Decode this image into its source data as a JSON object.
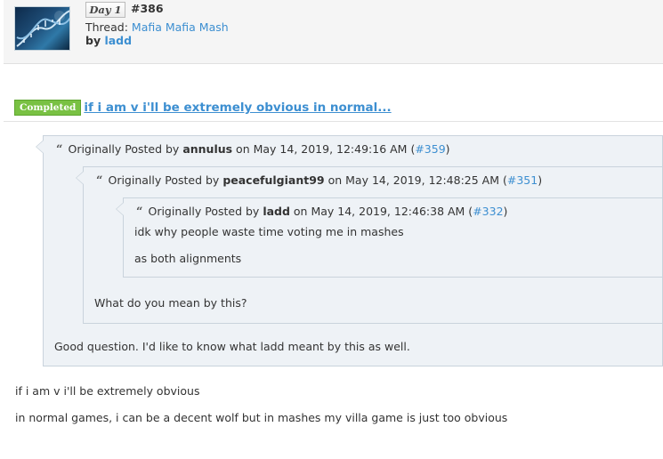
{
  "header": {
    "day_label": "Day 1",
    "post_number": "#386",
    "thread_prefix": "Thread: ",
    "thread_name": "Mafia Mafia Mash",
    "by_prefix": "by ",
    "author": "ladd",
    "avatar_icon": "dna-helix-icon"
  },
  "post": {
    "status_badge": "Completed",
    "status_color": "#79c143",
    "title": "if i am v i'll be extremely obvious in normal...",
    "link_color": "#3d8fd1"
  },
  "quotes": [
    {
      "prefix": "Originally Posted by ",
      "author": "annulus",
      "on": " on May 14, 2019, 12:49:16 AM (",
      "ref": "#359",
      "close": ")",
      "reply": "Good question. I'd like to know what ladd meant by this as well."
    },
    {
      "prefix": "Originally Posted by ",
      "author": "peacefulgiant99",
      "on": " on May 14, 2019, 12:48:25 AM (",
      "ref": "#351",
      "close": ")",
      "reply": "What do you mean by this?"
    },
    {
      "prefix": "Originally Posted by ",
      "author": "ladd",
      "on": " on May 14, 2019, 12:46:38 AM (",
      "ref": "#332",
      "close": ")",
      "lines": [
        "idk why people waste time voting me in mashes",
        "as both alignments"
      ]
    }
  ],
  "body": {
    "line1": "if i am v i'll be extremely obvious",
    "line2": "in normal games, i can be a decent wolf but in mashes my villa game is just too obvious"
  }
}
